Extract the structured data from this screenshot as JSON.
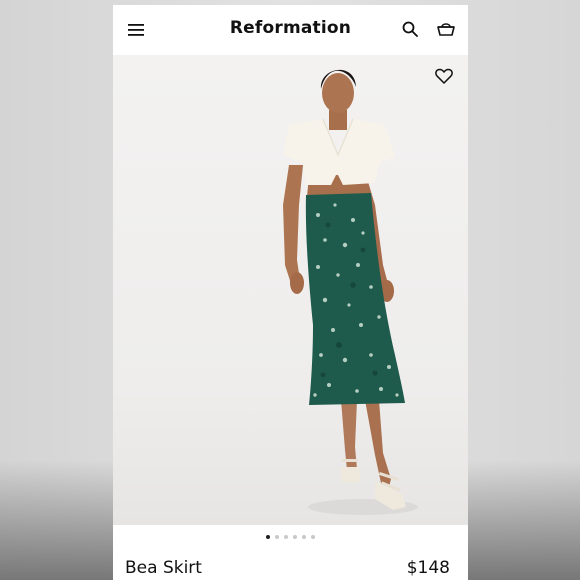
{
  "header": {
    "brand": "Reformation",
    "icons": [
      "menu-icon",
      "search-icon",
      "shopping-basket-icon"
    ]
  },
  "gallery": {
    "image_count": 6,
    "active_index": 0,
    "wishlist_icon": "heart-icon"
  },
  "product": {
    "name": "Bea Skirt",
    "price": "$148"
  },
  "colors": {
    "skirt_green": "#1f5b4c",
    "top_cream": "#f7f3ea",
    "text": "#111111"
  }
}
